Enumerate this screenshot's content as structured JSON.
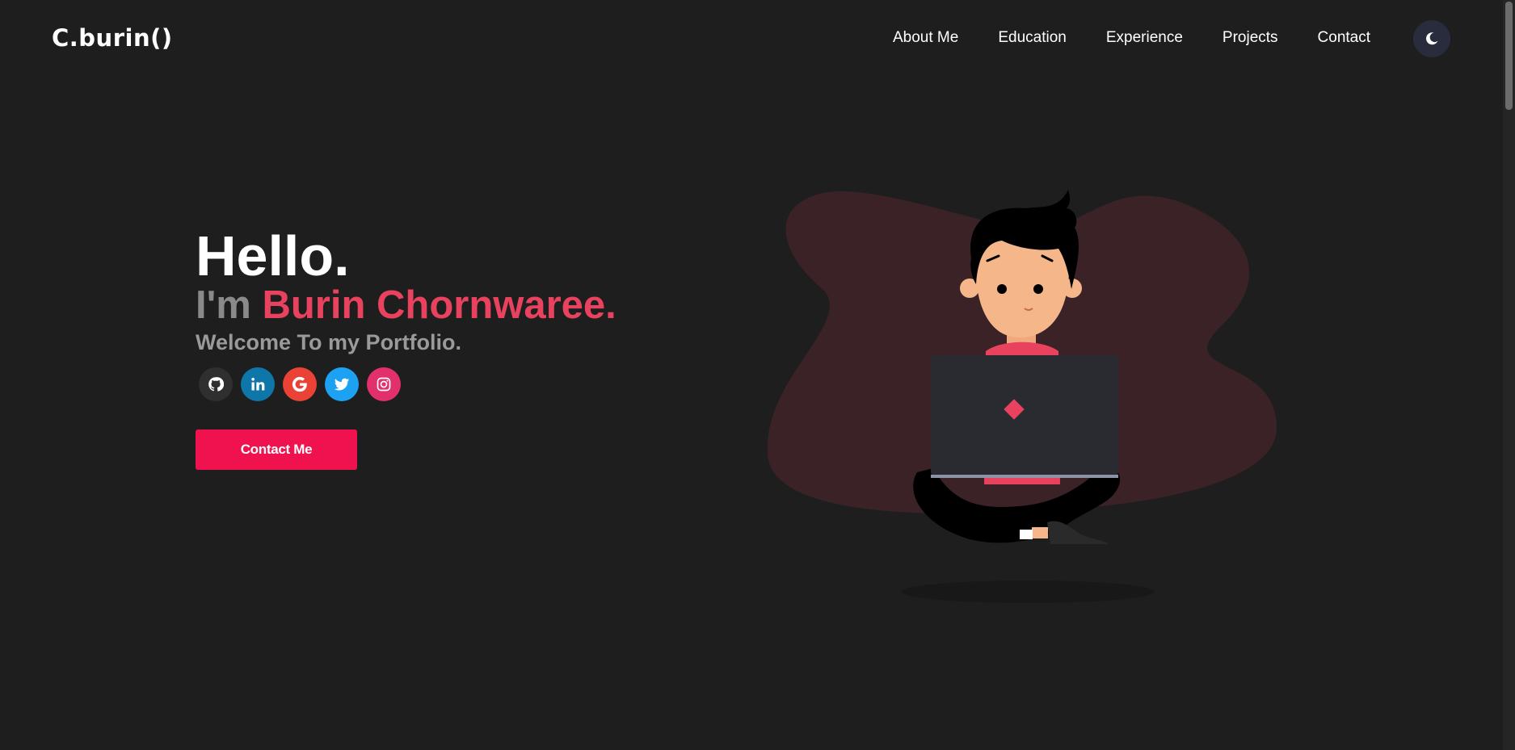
{
  "header": {
    "logo": "C.burin()",
    "nav": [
      "About Me",
      "Education",
      "Experience",
      "Projects",
      "Contact"
    ],
    "theme_toggle_icon": "moon-icon"
  },
  "hero": {
    "greeting": "Hello.",
    "intro_prefix": "I'm ",
    "name": "Burin Chornwaree.",
    "tagline": "Welcome To my Portfolio.",
    "socials": [
      {
        "icon": "github-icon",
        "color": "#2f2f2f"
      },
      {
        "icon": "linkedin-icon",
        "color": "#0e76a8"
      },
      {
        "icon": "google-icon",
        "color": "#ea4335"
      },
      {
        "icon": "twitter-icon",
        "color": "#1da1f2"
      },
      {
        "icon": "instagram-icon",
        "color": "#e1306c"
      }
    ],
    "cta_label": "Contact Me"
  },
  "colors": {
    "background": "#1e1e1e",
    "accent": "#e8425f",
    "cta": "#f0124f",
    "blob": "#3a2226"
  }
}
